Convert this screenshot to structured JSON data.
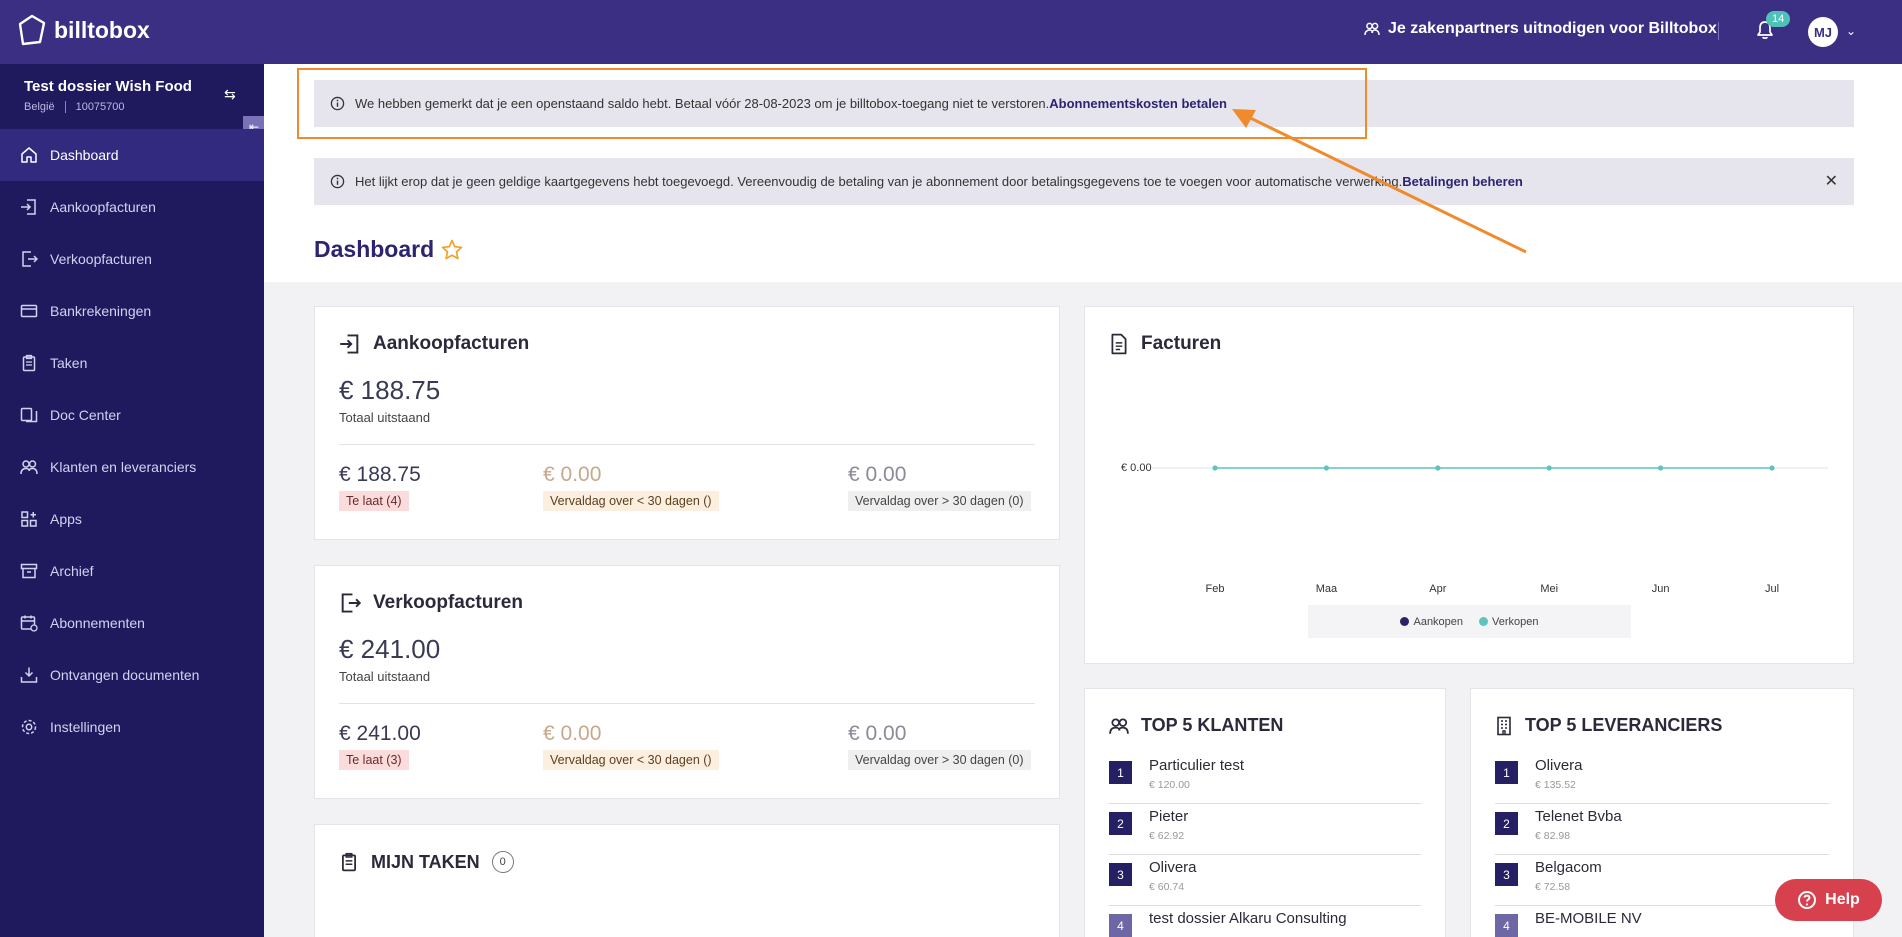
{
  "app": {
    "name": "billtobox"
  },
  "header": {
    "invite_label": "Je zakenpartners uitnodigen voor Billtobox",
    "notification_count": "14",
    "avatar_initials": "MJ"
  },
  "dossier": {
    "title": "Test dossier Wish Food",
    "country": "België",
    "number": "10075700"
  },
  "sidebar": {
    "items": [
      {
        "label": "Dashboard",
        "icon": "home-icon",
        "active": true
      },
      {
        "label": "Aankoopfacturen",
        "icon": "import-icon"
      },
      {
        "label": "Verkoopfacturen",
        "icon": "export-icon"
      },
      {
        "label": "Bankrekeningen",
        "icon": "card-icon"
      },
      {
        "label": "Taken",
        "icon": "clipboard-icon"
      },
      {
        "label": "Doc Center",
        "icon": "docs-icon"
      },
      {
        "label": "Klanten en leveranciers",
        "icon": "users-icon"
      },
      {
        "label": "Apps",
        "icon": "apps-icon"
      },
      {
        "label": "Archief",
        "icon": "archive-icon"
      },
      {
        "label": "Abonnementen",
        "icon": "calendar-icon"
      },
      {
        "label": "Ontvangen documenten",
        "icon": "inbox-icon"
      },
      {
        "label": "Instellingen",
        "icon": "gear-icon"
      }
    ]
  },
  "alerts": {
    "balance": {
      "text": "We hebben gemerkt dat je een openstaand saldo hebt. Betaal vóór 28-08-2023 om je billtobox-toegang niet te verstoren.",
      "link": "Abonnementskosten betalen"
    },
    "card": {
      "text": "Het lijkt erop dat je geen geldige kaartgegevens hebt toegevoegd. Vereenvoudig de betaling van je abonnement door betalingsgegevens toe te voegen voor automatische verwerking.",
      "link": "Betalingen beheren",
      "close": "✕"
    }
  },
  "page": {
    "title": "Dashboard"
  },
  "purchase": {
    "title": "Aankoopfacturen",
    "total": "€ 188.75",
    "total_label": "Totaal uitstaand",
    "late_amount": "€ 188.75",
    "late_label": "Te laat (4)",
    "soon_amount": "€ 0.00",
    "soon_label": "Vervaldag over < 30 dagen ()",
    "later_amount": "€ 0.00",
    "later_label": "Vervaldag over > 30 dagen (0)"
  },
  "sales": {
    "title": "Verkoopfacturen",
    "total": "€ 241.00",
    "total_label": "Totaal uitstaand",
    "late_amount": "€ 241.00",
    "late_label": "Te laat (3)",
    "soon_amount": "€ 0.00",
    "soon_label": "Vervaldag over < 30 dagen ()",
    "later_amount": "€ 0.00",
    "later_label": "Vervaldag over > 30 dagen (0)"
  },
  "tasks": {
    "title": "MIJN TAKEN",
    "count": "0"
  },
  "invoices_chart": {
    "title": "Facturen",
    "y_label": "€ 0.00",
    "months": [
      "Feb",
      "Maa",
      "Apr",
      "Mei",
      "Jun",
      "Jul"
    ],
    "legend": {
      "purchases": "Aankopen",
      "sales": "Verkopen"
    }
  },
  "top_clients": {
    "title": "TOP 5 KLANTEN",
    "items": [
      {
        "rank": "1",
        "name": "Particulier test",
        "value": "€ 120.00"
      },
      {
        "rank": "2",
        "name": "Pieter",
        "value": "€ 62.92"
      },
      {
        "rank": "3",
        "name": "Olivera",
        "value": "€ 60.74"
      },
      {
        "rank": "4",
        "name": "test dossier Alkaru Consulting",
        "value": ""
      }
    ]
  },
  "top_suppliers": {
    "title": "TOP 5 LEVERANCIERS",
    "items": [
      {
        "rank": "1",
        "name": "Olivera",
        "value": "€ 135.52"
      },
      {
        "rank": "2",
        "name": "Telenet Bvba",
        "value": "€ 82.98"
      },
      {
        "rank": "3",
        "name": "Belgacom",
        "value": "€ 72.58"
      },
      {
        "rank": "4",
        "name": "BE-MOBILE NV",
        "value": ""
      }
    ]
  },
  "help": {
    "label": "Help"
  },
  "colors": {
    "primary": "#3a2f83",
    "sidebar": "#1f1a5e",
    "accent_teal": "#4fc1b9",
    "highlight": "#f08a2a",
    "help": "#d7404d"
  }
}
